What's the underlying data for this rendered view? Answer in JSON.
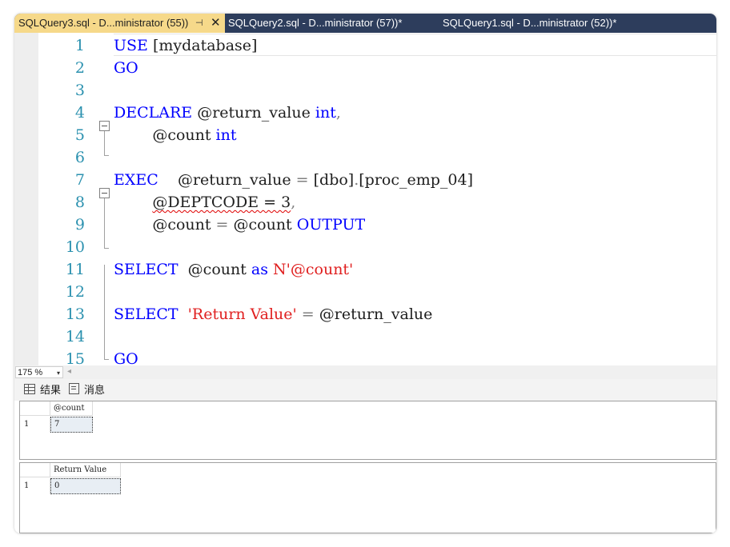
{
  "tabs": [
    {
      "label": "SQLQuery3.sql - D...ministrator (55))",
      "pin": "⊣",
      "close": "✕"
    },
    {
      "label": "SQLQuery2.sql - D...ministrator (57))*"
    },
    {
      "label": "SQLQuery1.sql - D...ministrator (52))*"
    }
  ],
  "editor": {
    "line_numbers": [
      "1",
      "2",
      "3",
      "4",
      "5",
      "6",
      "7",
      "8",
      "9",
      "10",
      "11",
      "12",
      "13",
      "14",
      "15"
    ],
    "code": {
      "l1_kw": "USE",
      "l1_rest": " [mydatabase]",
      "l2_kw": "GO",
      "l4_kw": "DECLARE",
      "l4_var": " @return_value ",
      "l4_type": "int",
      "l4_comma": ",",
      "l5_var": "        @count ",
      "l5_type": "int",
      "l7_kw": "EXEC",
      "l7_rest": "    @return_value ",
      "l7_eq": "=",
      "l7_obj1": " [dbo]",
      "l7_dot": ".",
      "l7_obj2": "[proc_emp_04]",
      "l8_indent": "        ",
      "l8_param": "@DEPTCODE = 3",
      "l8_comma": ",",
      "l9_var": "        @count ",
      "l9_eq": "=",
      "l9_var2": " @count ",
      "l9_kw": "OUTPUT",
      "l11_kw": "SELECT",
      "l11_var": "  @count ",
      "l11_as": "as",
      "l11_str": " N'@count'",
      "l13_kw": "SELECT",
      "l13_str": "  'Return Value'",
      "l13_eq": " =",
      "l13_var": " @return_value",
      "l15_kw": "GO"
    }
  },
  "zoom": {
    "value": "175 %",
    "arrow": "▾",
    "scroll_left": "◂"
  },
  "results_tabs": {
    "results": "结果",
    "messages": "消息"
  },
  "result1": {
    "column": "@count",
    "row_number": "1",
    "value": "7"
  },
  "result2": {
    "column": "Return Value",
    "row_number": "1",
    "value": "0"
  }
}
